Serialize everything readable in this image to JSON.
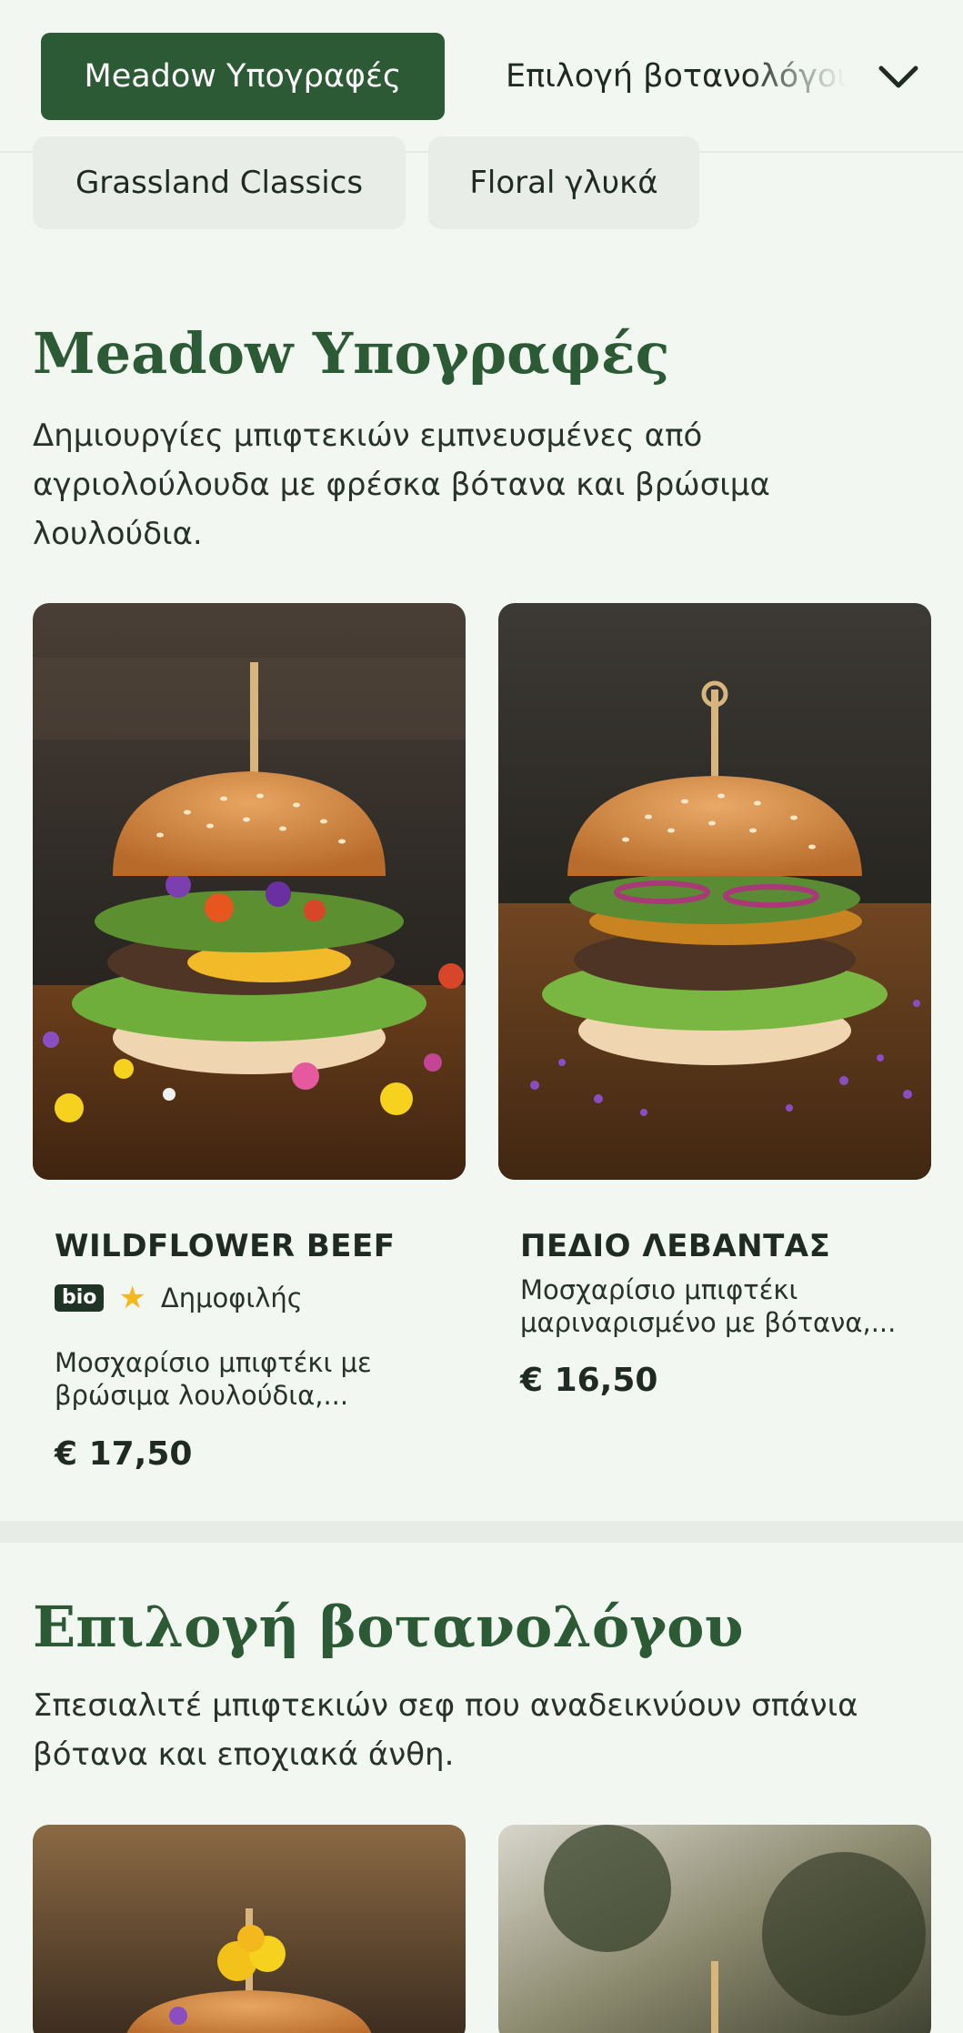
{
  "tabs": {
    "active": "Meadow Υπογραφές",
    "next": "Επιλογή βοτανολόγου"
  },
  "chips": [
    "Grassland Classics",
    "Floral γλυκά"
  ],
  "sections": [
    {
      "title": "Meadow Υπογραφές",
      "description": "Δημιουργίες μπιφτεκιών εμπνευσμένες από αγριολούλουδα με φρέσκα βότανα και βρώσιμα λουλούδια.",
      "items": [
        {
          "name": "WILDFLOWER BEEF",
          "badge": "bio",
          "popular": "Δημοφιλής",
          "description": "Μοσχαρίσιο μπιφτέκι με βρώσιμα λουλούδια,...",
          "price": "€ 17,50"
        },
        {
          "name": "ΠΕΔΙΟ ΛΕΒΑΝΤΑΣ",
          "description": "Μοσχαρίσιο μπιφτέκι μαριναρισμένο με βότανα,...",
          "price": "€ 16,50"
        }
      ]
    },
    {
      "title": "Επιλογή βοτανολόγου",
      "description": "Σπεσιαλιτέ μπιφτεκιών σεφ που αναδεικνύουν σπάνια βότανα και εποχιακά άνθη."
    }
  ],
  "colors": {
    "brand": "#2c5a34",
    "star": "#f3b81c",
    "background": "#f3f7f2"
  },
  "icons": {
    "dropdown": "chevron-down-icon",
    "rating": "star-icon"
  }
}
